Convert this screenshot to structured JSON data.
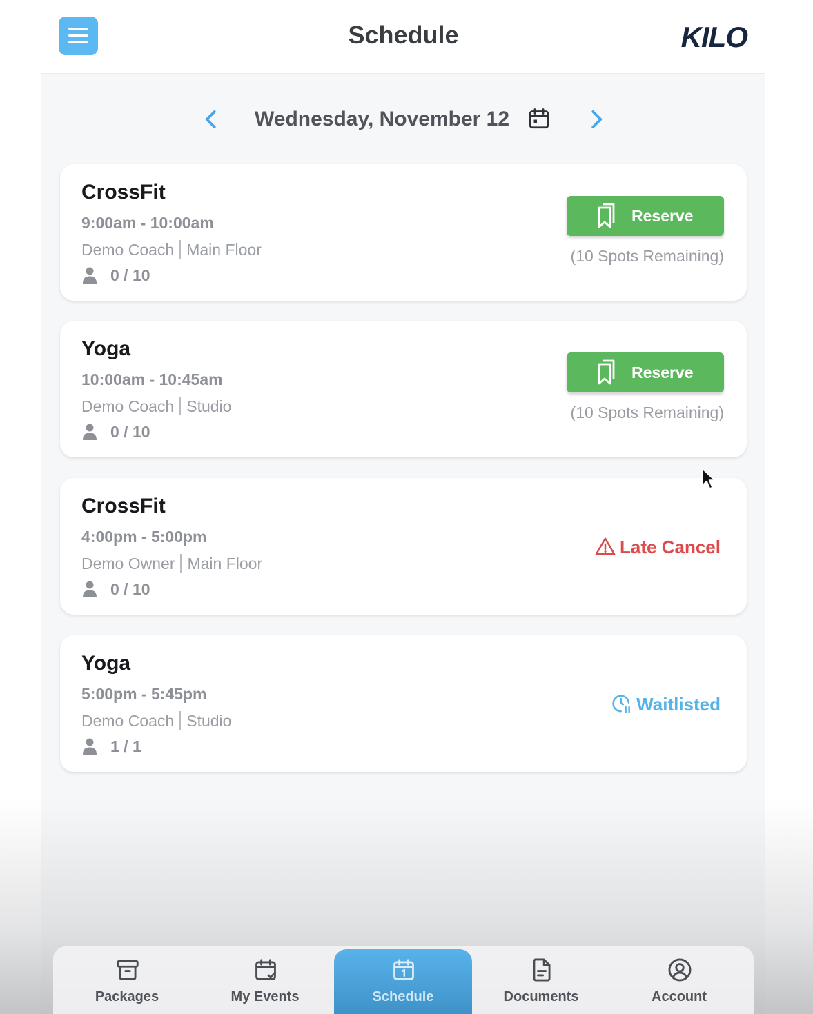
{
  "header": {
    "title": "Schedule",
    "logo": "KILO",
    "menu_icon": "hamburger-menu-icon"
  },
  "date_nav": {
    "date": "Wednesday, November 12",
    "prev_icon": "chevron-left-icon",
    "next_icon": "chevron-right-icon",
    "calendar_icon": "calendar-icon"
  },
  "colors": {
    "accent": "#5bb8f0",
    "reserve": "#5cb85c",
    "late_cancel": "#dc4b4b",
    "waitlisted": "#56b3ea"
  },
  "classes": [
    {
      "title": "CrossFit",
      "time": "9:00am - 10:00am",
      "coach": "Demo Coach",
      "location": "Main Floor",
      "count": "0 / 10",
      "action": "Reserve",
      "spots": "(10 Spots Remaining)"
    },
    {
      "title": "Yoga",
      "time": "10:00am - 10:45am",
      "coach": "Demo Coach",
      "location": "Studio",
      "count": "0 / 10",
      "action": "Reserve",
      "spots": "(10 Spots Remaining)"
    },
    {
      "title": "CrossFit",
      "time": "4:00pm - 5:00pm",
      "coach": "Demo Owner",
      "location": "Main Floor",
      "count": "0 / 10",
      "status": "Late Cancel"
    },
    {
      "title": "Yoga",
      "time": "5:00pm - 5:45pm",
      "coach": "Demo Coach",
      "location": "Studio",
      "count": "1 / 1",
      "status": "Waitlisted"
    }
  ],
  "bottom_nav": [
    {
      "label": "Packages",
      "icon": "archive-box-icon"
    },
    {
      "label": "My Events",
      "icon": "calendar-check-icon"
    },
    {
      "label": "Schedule",
      "icon": "calendar-icon",
      "active": true
    },
    {
      "label": "Documents",
      "icon": "document-icon"
    },
    {
      "label": "Account",
      "icon": "user-circle-icon"
    }
  ]
}
